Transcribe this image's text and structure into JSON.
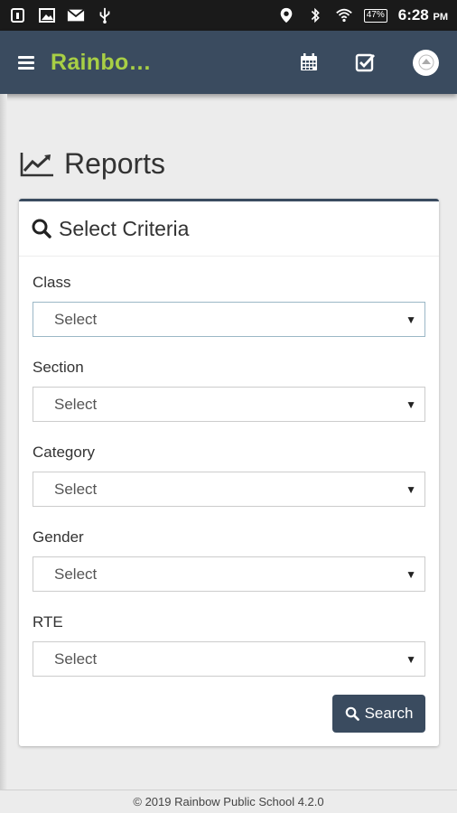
{
  "status_bar": {
    "battery": "47%",
    "time": "6:28",
    "ampm": "PM"
  },
  "app_bar": {
    "title": "Rainbo…"
  },
  "page": {
    "title": "Reports"
  },
  "criteria": {
    "title": "Select Criteria",
    "fields": [
      {
        "label": "Class",
        "value": "Select"
      },
      {
        "label": "Section",
        "value": "Select"
      },
      {
        "label": "Category",
        "value": "Select"
      },
      {
        "label": "Gender",
        "value": "Select"
      },
      {
        "label": "RTE",
        "value": "Select"
      }
    ],
    "search_label": "Search"
  },
  "footer": {
    "text": "© 2019 Rainbow Public School 4.2.0"
  },
  "colors": {
    "app_bar": "#3a4b5f",
    "brand": "#a8cf45",
    "button": "#3a4b5f"
  }
}
